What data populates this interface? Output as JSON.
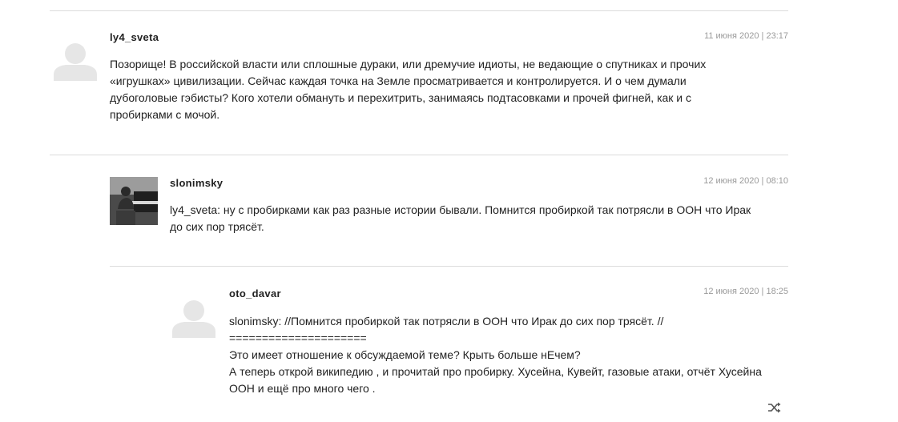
{
  "comments": [
    {
      "author": "ly4_sveta",
      "date": "11 июня 2020 | 23:17",
      "avatar": "default-avatar-icon",
      "text": "Позорище! В российской власти или сплошные дураки, или дремучие идиоты, не ведающие о спутниках и прочих «игрушках» цивилизации. Сейчас каждая точка на Земле просматривается и контролируется. И о чем думали дубоголовые гэбисты? Кого хотели обмануть и перехитрить, занимаясь подтасовками и прочей фигней, как и с пробирками с мочой."
    },
    {
      "author": "slonimsky",
      "date": "12 июня 2020 | 08:10",
      "avatar": "pianist-photo-avatar",
      "text": "ly4_sveta: ну с пробирками как раз разные истории бывали. Помнится пробиркой так потрясли в ООН что Ирак до сих пор трясёт."
    },
    {
      "author": "oto_davar",
      "date": "12 июня 2020 | 18:25",
      "avatar": "default-avatar-icon",
      "lines": [
        "slonimsky: //Помнится пробиркой так потрясли в ООН что Ирак до сих пор трясёт. //",
        "=====================",
        "Это имеет отношение к обсуждаемой теме? Крыть больше нЕчем?",
        "А теперь открой википедию , и прочитай про пробирку. Хусейна, Кувейт, газовые атаки, отчёт Хусейна ООН и ещё про много чего ."
      ]
    }
  ],
  "icons": {
    "shuffle": "shuffle-icon"
  },
  "colors": {
    "divider": "#dcdcdc",
    "meta": "#9a9a9a",
    "text": "#222222",
    "avatar_placeholder": "#e6e6e6"
  }
}
